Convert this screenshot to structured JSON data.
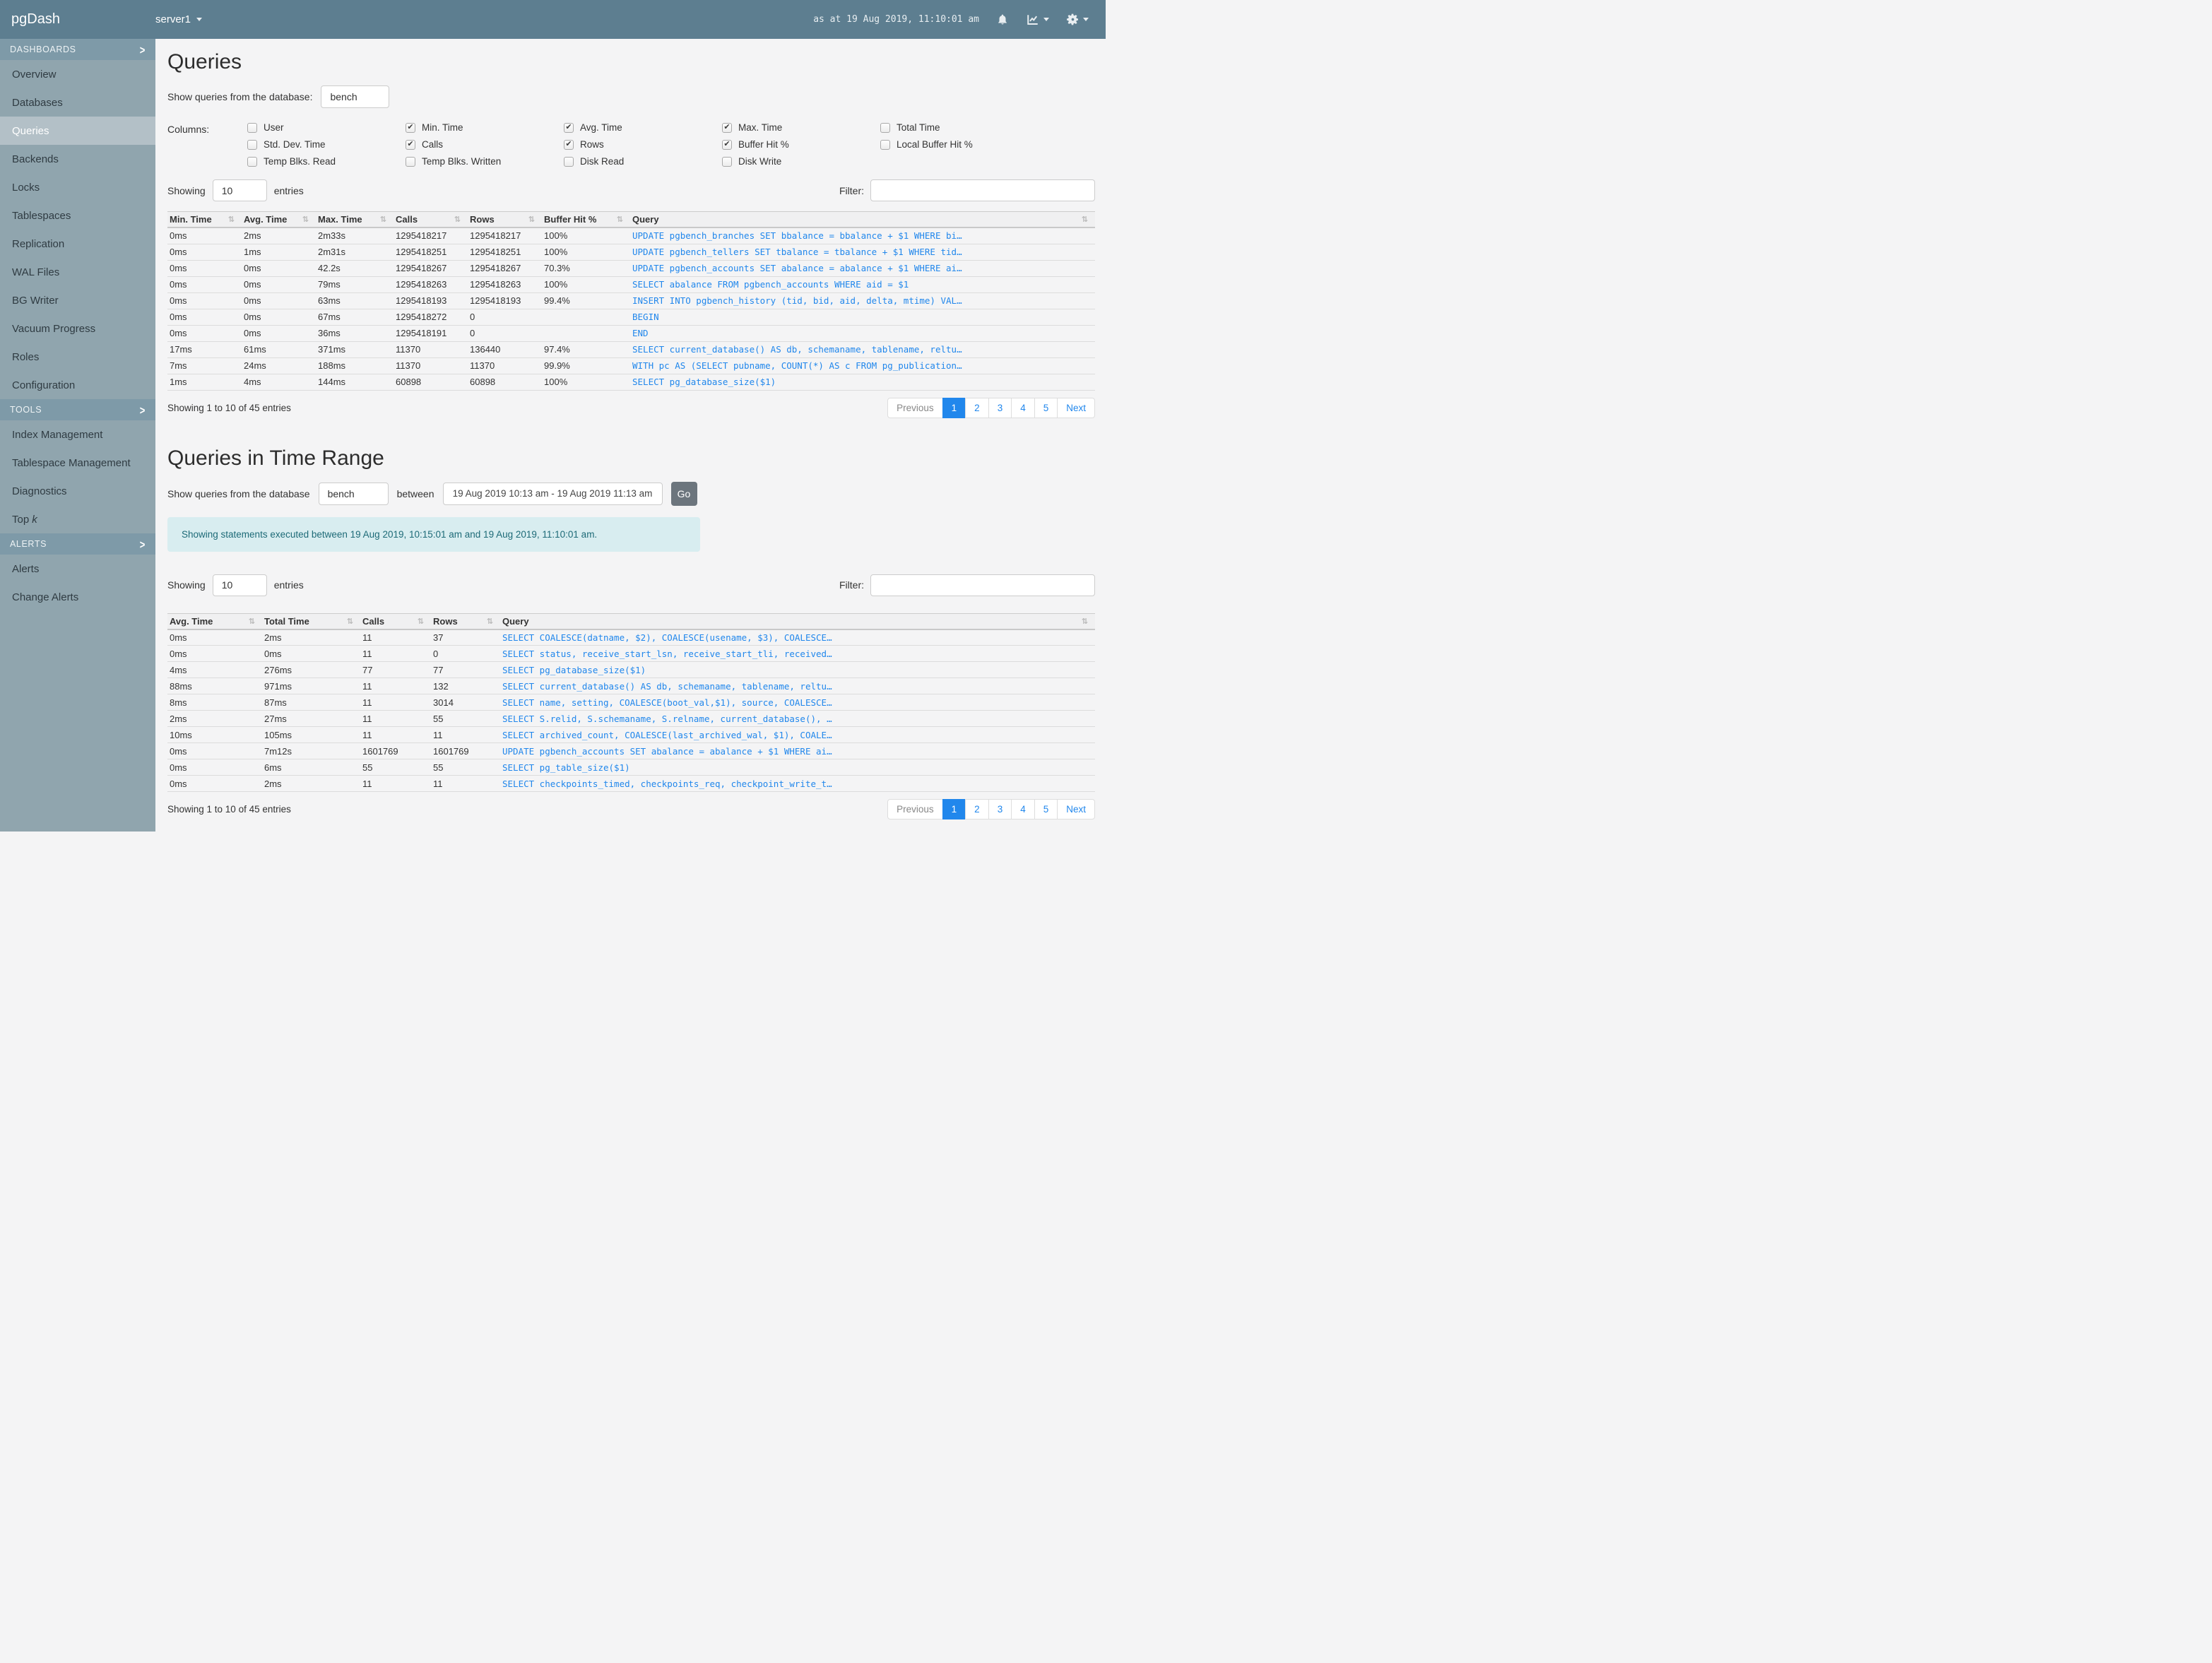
{
  "navbar": {
    "brand": "pgDash",
    "server": "server1",
    "timestamp": "as at 19 Aug 2019, 11:10:01 am"
  },
  "sidebar": {
    "sections": [
      {
        "label": "DASHBOARDS",
        "active": "Queries",
        "items": [
          "Overview",
          "Databases",
          "Queries",
          "Backends",
          "Locks",
          "Tablespaces",
          "Replication",
          "WAL Files",
          "BG Writer",
          "Vacuum Progress",
          "Roles",
          "Configuration"
        ]
      },
      {
        "label": "TOOLS",
        "items": [
          "Index Management",
          "Tablespace Management",
          "Diagnostics",
          {
            "text": "Top",
            "italic_suffix": "k"
          }
        ]
      },
      {
        "label": "ALERTS",
        "items": [
          "Alerts",
          "Change Alerts"
        ]
      }
    ]
  },
  "controls": {
    "showing": "Showing",
    "entries_value": "10",
    "entries": "entries",
    "filter": "Filter:",
    "filter_value": ""
  },
  "queries": {
    "title": "Queries",
    "db_label": "Show queries from the database:",
    "db_value": "bench",
    "columns_label": "Columns:",
    "checkbox_groups": [
      [
        {
          "label": "User",
          "checked": false
        },
        {
          "label": "Std. Dev. Time",
          "checked": false
        },
        {
          "label": "Temp Blks. Read",
          "checked": false
        }
      ],
      [
        {
          "label": "Min. Time",
          "checked": true
        },
        {
          "label": "Calls",
          "checked": true
        },
        {
          "label": "Temp Blks. Written",
          "checked": false
        }
      ],
      [
        {
          "label": "Avg. Time",
          "checked": true
        },
        {
          "label": "Rows",
          "checked": true
        },
        {
          "label": "Disk Read",
          "checked": false
        }
      ],
      [
        {
          "label": "Max. Time",
          "checked": true
        },
        {
          "label": "Buffer Hit %",
          "checked": true
        },
        {
          "label": "Disk Write",
          "checked": false
        }
      ],
      [
        {
          "label": "Total Time",
          "checked": false
        },
        {
          "label": "Local Buffer Hit %",
          "checked": false
        }
      ]
    ],
    "table": {
      "headers": [
        "Min. Time",
        "Avg. Time",
        "Max. Time",
        "Calls",
        "Rows",
        "Buffer Hit %",
        "Query"
      ],
      "rows": [
        [
          "0ms",
          "2ms",
          "2m33s",
          "1295418217",
          "1295418217",
          "100%",
          "UPDATE pgbench_branches SET bbalance = bbalance + $1 WHERE bi…"
        ],
        [
          "0ms",
          "1ms",
          "2m31s",
          "1295418251",
          "1295418251",
          "100%",
          "UPDATE pgbench_tellers SET tbalance = tbalance + $1 WHERE tid…"
        ],
        [
          "0ms",
          "0ms",
          "42.2s",
          "1295418267",
          "1295418267",
          "70.3%",
          "UPDATE pgbench_accounts SET abalance = abalance + $1 WHERE ai…"
        ],
        [
          "0ms",
          "0ms",
          "79ms",
          "1295418263",
          "1295418263",
          "100%",
          "SELECT abalance FROM pgbench_accounts WHERE aid = $1"
        ],
        [
          "0ms",
          "0ms",
          "63ms",
          "1295418193",
          "1295418193",
          "99.4%",
          "INSERT INTO pgbench_history (tid, bid, aid, delta, mtime) VAL…"
        ],
        [
          "0ms",
          "0ms",
          "67ms",
          "1295418272",
          "0",
          "",
          "BEGIN"
        ],
        [
          "0ms",
          "0ms",
          "36ms",
          "1295418191",
          "0",
          "",
          "END"
        ],
        [
          "17ms",
          "61ms",
          "371ms",
          "11370",
          "136440",
          "97.4%",
          "SELECT current_database() AS db, schemaname, tablename, reltu…"
        ],
        [
          "7ms",
          "24ms",
          "188ms",
          "11370",
          "11370",
          "99.9%",
          "WITH pc AS (SELECT pubname, COUNT(*) AS c FROM pg_publication…"
        ],
        [
          "1ms",
          "4ms",
          "144ms",
          "60898",
          "60898",
          "100%",
          "SELECT pg_database_size($1)"
        ]
      ]
    },
    "summary": "Showing 1 to 10 of 45 entries"
  },
  "range": {
    "title": "Queries in Time Range",
    "db_label": "Show queries from the database",
    "db_value": "bench",
    "between_label": "between",
    "range_value": "19 Aug 2019 10:13 am - 19 Aug 2019 11:13 am",
    "go_label": "Go",
    "alert": "Showing statements executed between 19 Aug 2019, 10:15:01 am and 19 Aug 2019, 11:10:01 am.",
    "table": {
      "headers": [
        "Avg. Time",
        "Total Time",
        "Calls",
        "Rows",
        "Query"
      ],
      "rows": [
        [
          "0ms",
          "2ms",
          "11",
          "37",
          "SELECT COALESCE(datname, $2), COALESCE(usename, $3), COALESCE…"
        ],
        [
          "0ms",
          "0ms",
          "11",
          "0",
          "SELECT status, receive_start_lsn, receive_start_tli, received…"
        ],
        [
          "4ms",
          "276ms",
          "77",
          "77",
          "SELECT pg_database_size($1)"
        ],
        [
          "88ms",
          "971ms",
          "11",
          "132",
          "SELECT current_database() AS db, schemaname, tablename, reltu…"
        ],
        [
          "8ms",
          "87ms",
          "11",
          "3014",
          "SELECT name, setting, COALESCE(boot_val,$1), source, COALESCE…"
        ],
        [
          "2ms",
          "27ms",
          "11",
          "55",
          "SELECT S.relid, S.schemaname, S.relname, current_database(), …"
        ],
        [
          "10ms",
          "105ms",
          "11",
          "11",
          "SELECT archived_count, COALESCE(last_archived_wal, $1), COALE…"
        ],
        [
          "0ms",
          "7m12s",
          "1601769",
          "1601769",
          "UPDATE pgbench_accounts SET abalance = abalance + $1 WHERE ai…"
        ],
        [
          "0ms",
          "6ms",
          "55",
          "55",
          "SELECT pg_table_size($1)"
        ],
        [
          "0ms",
          "2ms",
          "11",
          "11",
          "SELECT checkpoints_timed, checkpoints_req, checkpoint_write_t…"
        ]
      ]
    },
    "summary": "Showing 1 to 10 of 45 entries"
  },
  "pagination": {
    "previous": "Previous",
    "pages": [
      "1",
      "2",
      "3",
      "4",
      "5"
    ],
    "active": "1",
    "next": "Next"
  },
  "colors": {
    "navbar": "#5d7e90",
    "sidebar": "#90a5ae",
    "sidebar_header": "#7e9aa8",
    "sidebar_active_item": "#b3c0c7",
    "link": "#2187ec",
    "alert_bg": "#d8edf0",
    "alert_text": "#1d6a77",
    "go_button": "#6c757d"
  }
}
